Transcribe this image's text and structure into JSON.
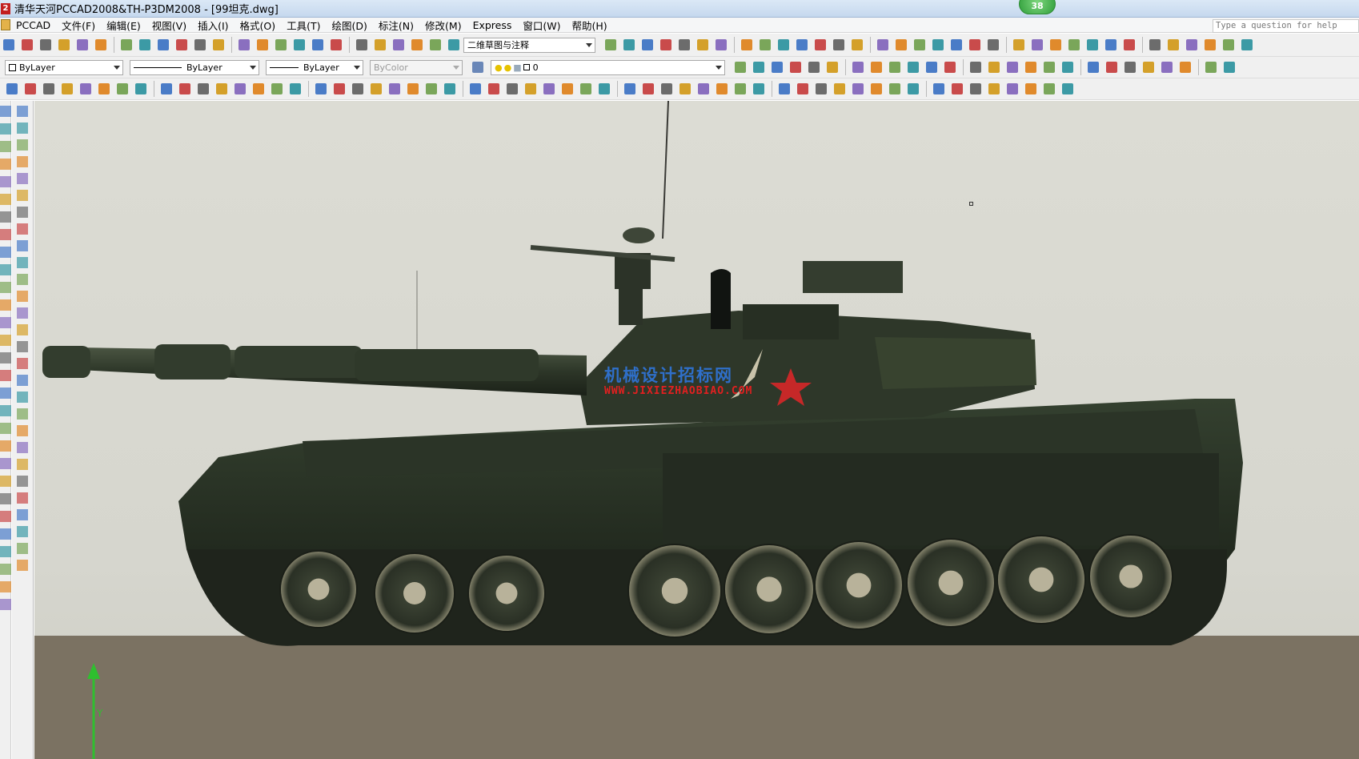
{
  "window": {
    "title": "清华天河PCCAD2008&TH-P3DM2008 - [99坦克.dwg]",
    "notification_count": "38"
  },
  "menu": {
    "items": [
      "PCCAD",
      "文件(F)",
      "编辑(E)",
      "视图(V)",
      "插入(I)",
      "格式(O)",
      "工具(T)",
      "绘图(D)",
      "标注(N)",
      "修改(M)",
      "Express",
      "窗口(W)",
      "帮助(H)"
    ],
    "help_placeholder": "Type a question for help"
  },
  "toolbar1": {
    "workspace_combo": "二维草图与注释"
  },
  "toolbar2": {
    "color_combo": "ByLayer",
    "linetype_combo": "ByLayer",
    "lineweight_combo": "ByLayer",
    "plotstyle_combo": "ByColor",
    "layer_combo": "0"
  },
  "viewport": {
    "ucs_axis_label": "Y",
    "watermark_title": "机械设计招标网",
    "watermark_url": "WWW.JIXIEZHAOBIAO.COM",
    "model": "99坦克"
  },
  "colors": {
    "titlebar": "#c5d8ee",
    "viewport_background": "#d8d8d0",
    "ground": "#7b7262",
    "tank_body": "#2a3326",
    "star": "#c62828"
  }
}
